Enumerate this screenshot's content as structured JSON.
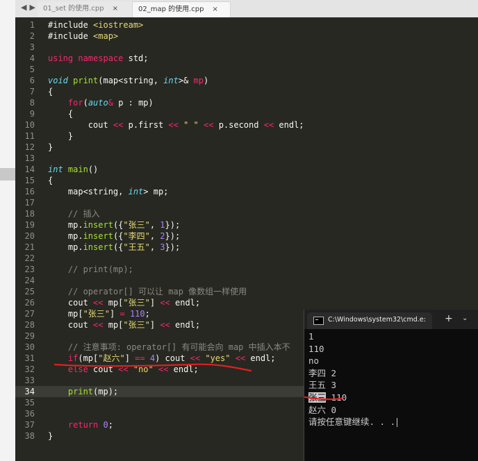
{
  "tabs": [
    {
      "label": "01_set 的使用.cpp",
      "active": false
    },
    {
      "label": "02_map 的使用.cpp",
      "active": true
    }
  ],
  "nav": {
    "back": "◀",
    "forward": "▶"
  },
  "close_glyph": "×",
  "editor": {
    "current_line": 34,
    "lines": [
      {
        "n": "1",
        "tokens": [
          [
            "prep",
            "#include "
          ],
          [
            "str",
            "<iostream>"
          ]
        ]
      },
      {
        "n": "2",
        "tokens": [
          [
            "prep",
            "#include "
          ],
          [
            "str",
            "<map>"
          ]
        ]
      },
      {
        "n": "3",
        "tokens": []
      },
      {
        "n": "4",
        "tokens": [
          [
            "key",
            "using "
          ],
          [
            "key",
            "namespace "
          ],
          [
            "plain",
            "std;"
          ]
        ]
      },
      {
        "n": "5",
        "tokens": []
      },
      {
        "n": "6",
        "tokens": [
          [
            "type",
            "void "
          ],
          [
            "fn",
            "print"
          ],
          [
            "plain",
            "(map<string, "
          ],
          [
            "type",
            "int"
          ],
          [
            "plain",
            ">& "
          ],
          [
            "op",
            "mp"
          ],
          [
            "plain",
            ")"
          ]
        ]
      },
      {
        "n": "7",
        "tokens": [
          [
            "plain",
            "{"
          ]
        ]
      },
      {
        "n": "8",
        "tokens": [
          [
            "plain",
            "    "
          ],
          [
            "key",
            "for"
          ],
          [
            "plain",
            "("
          ],
          [
            "type",
            "auto"
          ],
          [
            "op",
            "& "
          ],
          [
            "plain",
            "p : mp)"
          ]
        ]
      },
      {
        "n": "9",
        "tokens": [
          [
            "plain",
            "    {"
          ]
        ]
      },
      {
        "n": "10",
        "tokens": [
          [
            "plain",
            "        cout "
          ],
          [
            "op",
            "<< "
          ],
          [
            "plain",
            "p.first "
          ],
          [
            "op",
            "<< "
          ],
          [
            "str",
            "\" \" "
          ],
          [
            "op",
            "<< "
          ],
          [
            "plain",
            "p.second "
          ],
          [
            "op",
            "<< "
          ],
          [
            "plain",
            "endl;"
          ]
        ]
      },
      {
        "n": "11",
        "tokens": [
          [
            "plain",
            "    }"
          ]
        ]
      },
      {
        "n": "12",
        "tokens": [
          [
            "plain",
            "}"
          ]
        ]
      },
      {
        "n": "13",
        "tokens": []
      },
      {
        "n": "14",
        "tokens": [
          [
            "type",
            "int "
          ],
          [
            "fn",
            "main"
          ],
          [
            "plain",
            "()"
          ]
        ]
      },
      {
        "n": "15",
        "tokens": [
          [
            "plain",
            "{"
          ]
        ]
      },
      {
        "n": "16",
        "tokens": [
          [
            "plain",
            "    map<string, "
          ],
          [
            "type",
            "int"
          ],
          [
            "plain",
            "> mp;"
          ]
        ]
      },
      {
        "n": "17",
        "tokens": []
      },
      {
        "n": "18",
        "tokens": [
          [
            "com",
            "    // 插入"
          ]
        ]
      },
      {
        "n": "19",
        "tokens": [
          [
            "plain",
            "    mp."
          ],
          [
            "fn",
            "insert"
          ],
          [
            "plain",
            "({"
          ],
          [
            "str",
            "\"张三\""
          ],
          [
            "plain",
            ", "
          ],
          [
            "num",
            "1"
          ],
          [
            "plain",
            "});"
          ]
        ]
      },
      {
        "n": "20",
        "tokens": [
          [
            "plain",
            "    mp."
          ],
          [
            "fn",
            "insert"
          ],
          [
            "plain",
            "({"
          ],
          [
            "str",
            "\"李四\""
          ],
          [
            "plain",
            ", "
          ],
          [
            "num",
            "2"
          ],
          [
            "plain",
            "});"
          ]
        ]
      },
      {
        "n": "21",
        "tokens": [
          [
            "plain",
            "    mp."
          ],
          [
            "fn",
            "insert"
          ],
          [
            "plain",
            "({"
          ],
          [
            "str",
            "\"王五\""
          ],
          [
            "plain",
            ", "
          ],
          [
            "num",
            "3"
          ],
          [
            "plain",
            "});"
          ]
        ]
      },
      {
        "n": "22",
        "tokens": []
      },
      {
        "n": "23",
        "tokens": [
          [
            "com",
            "    // print(mp);"
          ]
        ]
      },
      {
        "n": "24",
        "tokens": []
      },
      {
        "n": "25",
        "tokens": [
          [
            "com",
            "    // operator[] 可以让 map 像数组一样使用"
          ]
        ]
      },
      {
        "n": "26",
        "tokens": [
          [
            "plain",
            "    cout "
          ],
          [
            "op",
            "<< "
          ],
          [
            "plain",
            "mp["
          ],
          [
            "str",
            "\"张三\""
          ],
          [
            "plain",
            "] "
          ],
          [
            "op",
            "<< "
          ],
          [
            "plain",
            "endl;"
          ]
        ]
      },
      {
        "n": "27",
        "tokens": [
          [
            "plain",
            "    mp["
          ],
          [
            "str",
            "\"张三\""
          ],
          [
            "plain",
            "] "
          ],
          [
            "op",
            "= "
          ],
          [
            "num",
            "110"
          ],
          [
            "plain",
            ";"
          ]
        ]
      },
      {
        "n": "28",
        "tokens": [
          [
            "plain",
            "    cout "
          ],
          [
            "op",
            "<< "
          ],
          [
            "plain",
            "mp["
          ],
          [
            "str",
            "\"张三\""
          ],
          [
            "plain",
            "] "
          ],
          [
            "op",
            "<< "
          ],
          [
            "plain",
            "endl;"
          ]
        ]
      },
      {
        "n": "29",
        "tokens": []
      },
      {
        "n": "30",
        "tokens": [
          [
            "com",
            "    // 注意事项: operator[] 有可能会向 map 中插入本不"
          ]
        ]
      },
      {
        "n": "31",
        "tokens": [
          [
            "plain",
            "    "
          ],
          [
            "key",
            "if"
          ],
          [
            "plain",
            "(mp["
          ],
          [
            "str",
            "\"赵六\""
          ],
          [
            "plain",
            "] "
          ],
          [
            "op",
            "== "
          ],
          [
            "num",
            "4"
          ],
          [
            "plain",
            ") cout "
          ],
          [
            "op",
            "<< "
          ],
          [
            "str",
            "\"yes\" "
          ],
          [
            "op",
            "<< "
          ],
          [
            "plain",
            "endl;"
          ]
        ]
      },
      {
        "n": "32",
        "tokens": [
          [
            "plain",
            "    "
          ],
          [
            "key",
            "else "
          ],
          [
            "plain",
            "cout "
          ],
          [
            "op",
            "<< "
          ],
          [
            "str",
            "\"no\" "
          ],
          [
            "op",
            "<< "
          ],
          [
            "plain",
            "endl;"
          ]
        ]
      },
      {
        "n": "33",
        "tokens": []
      },
      {
        "n": "34",
        "tokens": [
          [
            "plain",
            "    "
          ],
          [
            "fn",
            "print"
          ],
          [
            "plain",
            "(mp);"
          ]
        ]
      },
      {
        "n": "35",
        "tokens": []
      },
      {
        "n": "36",
        "tokens": []
      },
      {
        "n": "37",
        "tokens": [
          [
            "plain",
            "    "
          ],
          [
            "key",
            "return "
          ],
          [
            "num",
            "0"
          ],
          [
            "plain",
            ";"
          ]
        ]
      },
      {
        "n": "38",
        "tokens": [
          [
            "plain",
            "}"
          ]
        ]
      }
    ]
  },
  "console": {
    "title": "C:\\Windows\\system32\\cmd.e:",
    "plus": "+",
    "chevron": "⌄",
    "lines": [
      {
        "text": "1"
      },
      {
        "text": "110"
      },
      {
        "text": "no"
      },
      {
        "text": "李四 2"
      },
      {
        "text": "王五 3"
      },
      {
        "sel": "张三",
        "rest": " 110"
      },
      {
        "text": "赵六 0"
      },
      {
        "text": "请按任意键继续. . ."
      }
    ]
  },
  "colors": {
    "editor_bg": "#272822",
    "annotation_red": "#e02020",
    "console_bg": "#0c0c0c"
  }
}
